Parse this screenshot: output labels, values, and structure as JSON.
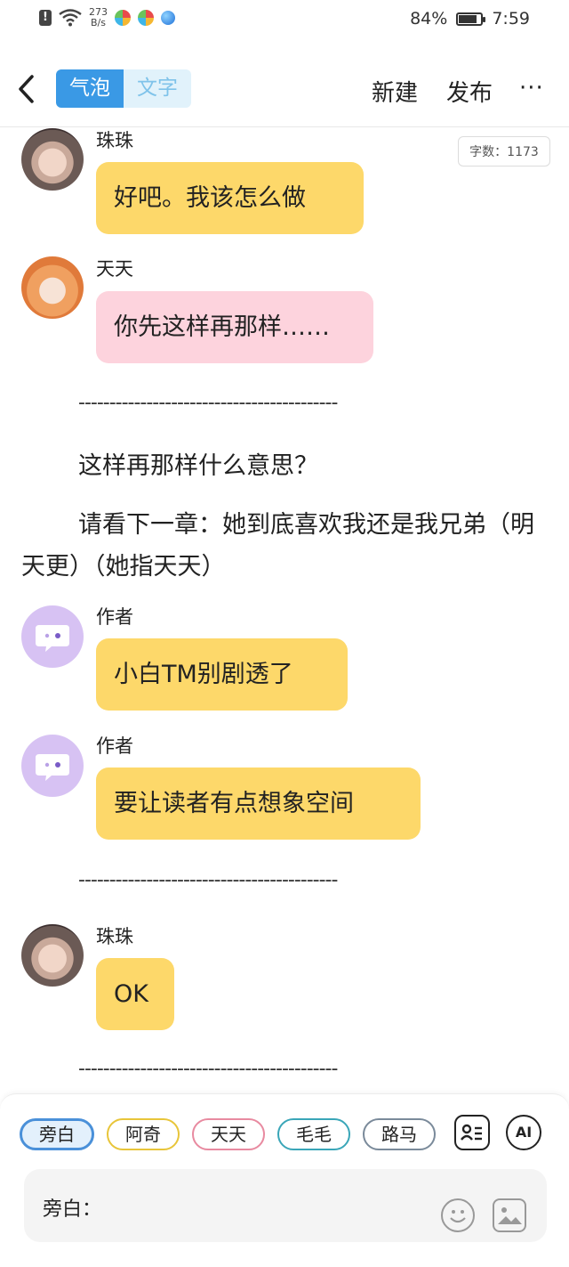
{
  "status_bar": {
    "net_speed_value": "273",
    "net_speed_unit": "B/s",
    "battery": "84%",
    "battery_level": 0.84,
    "time": "7:59"
  },
  "nav": {
    "back_icon": "chevron-left-icon",
    "mode_tabs": [
      "气泡",
      "文字"
    ],
    "active_tab": "气泡",
    "new_label": "新建",
    "publish_label": "发布",
    "more_label": "···"
  },
  "word_count": "字数：1173",
  "chat": {
    "m1": {
      "speaker": "珠珠",
      "text": "好吧。我该怎么做",
      "color": "#fdd86a"
    },
    "m2": {
      "speaker": "天天",
      "text": "你先这样再那样……",
      "color": "#fdd3dd"
    },
    "sep1": "------------------------------------------",
    "narr1": "这样再那样什么意思？",
    "narr2": "请看下一章：她到底喜欢我还是我兄弟（明天更）（她指天天）",
    "m3": {
      "speaker": "作者",
      "text": "小白TM别剧透了",
      "color": "#fdd86a"
    },
    "m4": {
      "speaker": "作者",
      "text": "要让读者有点想象空间",
      "color": "#fdd86a"
    },
    "sep2": "------------------------------------------",
    "m5": {
      "speaker": "珠珠",
      "text": "OK",
      "color": "#fdd86a"
    },
    "sep3": "------------------------------------------"
  },
  "characters": [
    {
      "name": "旁白",
      "color": "#4a90d9",
      "selected": true
    },
    {
      "name": "阿奇",
      "color": "#e8c53a"
    },
    {
      "name": "天天",
      "color": "#e88aa0"
    },
    {
      "name": "毛毛",
      "color": "#3aa6b8"
    },
    {
      "name": "路马",
      "color": "#7a8a9a"
    }
  ],
  "tools": {
    "ai_label": "AI",
    "card_icon": "character-card-icon",
    "emoji_icon": "smile-icon",
    "image_icon": "image-icon"
  },
  "input": {
    "label": "旁白："
  }
}
